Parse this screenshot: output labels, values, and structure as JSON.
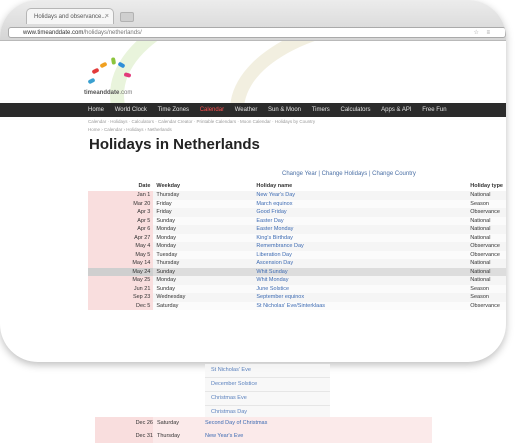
{
  "browser": {
    "tab_title": "Holidays and observance...",
    "tab_close": "×",
    "url_host": "www.timeanddate.com",
    "url_path": "/holidays/netherlands/",
    "url_icons": "☆ ≡"
  },
  "site": {
    "logo_text": "timeanddate",
    "logo_domain": ".com",
    "nav": [
      "Home",
      "World Clock",
      "Time Zones",
      "Calendar",
      "Weather",
      "Sun & Moon",
      "Timers",
      "Calculators",
      "Apps & API",
      "Free Fun"
    ],
    "active_nav": "Calendar",
    "subnav": "Calendar · Holidays · Calculators · Calendar Creator · Printable Calendars · Moon Calendar · Holidays by Country",
    "breadcrumb": "Home › Calendar › Holidays › Netherlands",
    "page_title": "Holidays in Netherlands",
    "top_links": "Change Year | Change Holidays | Change Country",
    "brand_colors": {
      "active_nav": "#ff4f4f",
      "link": "#3d6bb3",
      "date_cell": "#f9dede"
    }
  },
  "table": {
    "headers": [
      "Date",
      "Weekday",
      "Holiday name",
      "Holiday type"
    ],
    "rows": [
      {
        "date": "Jan 1",
        "weekday": "Thursday",
        "name": "New Year's Day",
        "type": "National"
      },
      {
        "date": "Mar 20",
        "weekday": "Friday",
        "name": "March equinox",
        "type": "Season"
      },
      {
        "date": "Apr 3",
        "weekday": "Friday",
        "name": "Good Friday",
        "type": "Observance"
      },
      {
        "date": "Apr 5",
        "weekday": "Sunday",
        "name": "Easter Day",
        "type": "National"
      },
      {
        "date": "Apr 6",
        "weekday": "Monday",
        "name": "Easter Monday",
        "type": "National"
      },
      {
        "date": "Apr 27",
        "weekday": "Monday",
        "name": "King's Birthday",
        "type": "National"
      },
      {
        "date": "May 4",
        "weekday": "Monday",
        "name": "Remembrance Day",
        "type": "Observance"
      },
      {
        "date": "May 5",
        "weekday": "Tuesday",
        "name": "Liberation Day",
        "type": "Observance"
      },
      {
        "date": "May 14",
        "weekday": "Thursday",
        "name": "Ascension Day",
        "type": "National"
      },
      {
        "date": "May 24",
        "weekday": "Sunday",
        "name": "Whit Sunday",
        "type": "National"
      },
      {
        "date": "May 25",
        "weekday": "Monday",
        "name": "Whit Monday",
        "type": "National"
      },
      {
        "date": "Jun 21",
        "weekday": "Sunday",
        "name": "June Solstice",
        "type": "Season"
      },
      {
        "date": "Sep 23",
        "weekday": "Wednesday",
        "name": "September equinox",
        "type": "Season"
      },
      {
        "date": "Dec 5",
        "weekday": "Saturday",
        "name": "St Nicholas' Eve/Sinterklaas",
        "type": "Observance"
      }
    ],
    "highlight_index": 9
  },
  "reflection": {
    "items": [
      "St Nicholas' Eve",
      "December Solstice",
      "Christmas Eve",
      "Christmas Day"
    ]
  },
  "bottom_rows": [
    {
      "date": "Dec 26",
      "weekday": "Saturday",
      "name": "Second Day of Christmas"
    },
    {
      "date": "Dec 31",
      "weekday": "Thursday",
      "name": "New Year's Eve"
    }
  ]
}
